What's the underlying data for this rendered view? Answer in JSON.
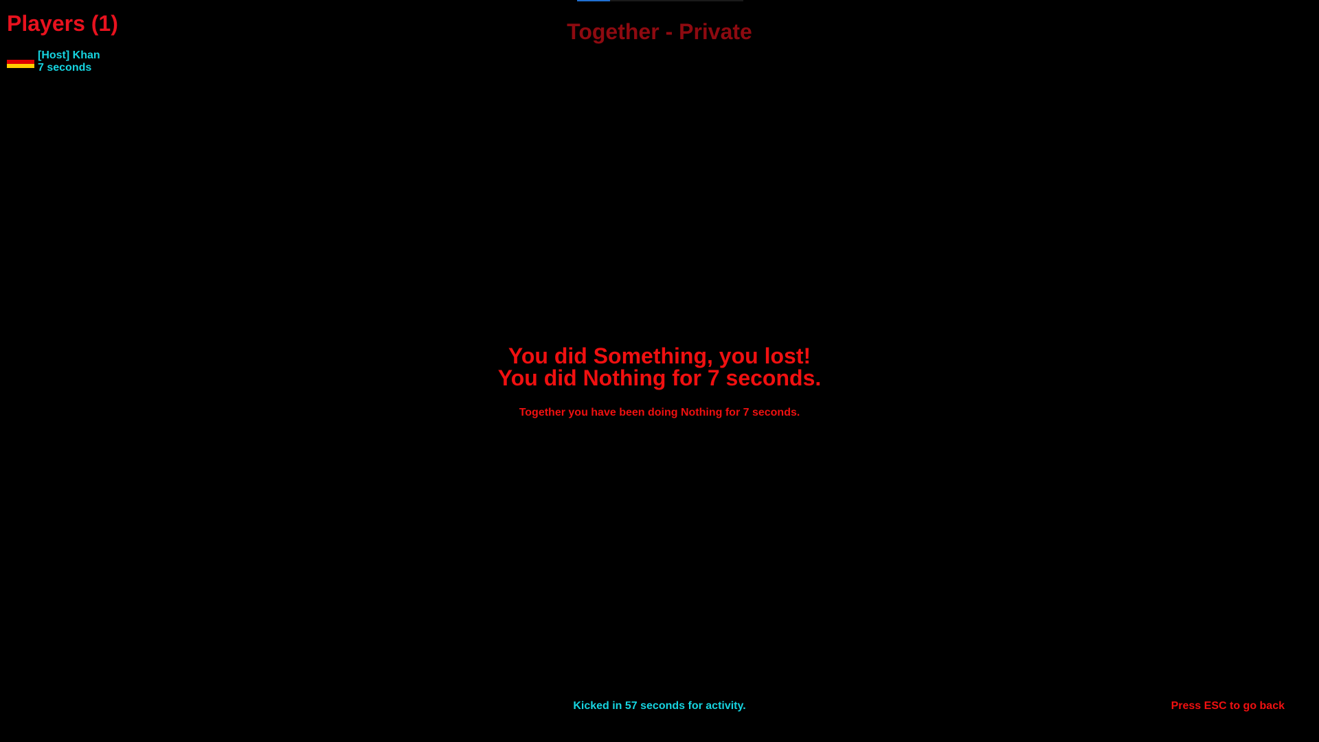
{
  "top_progress": {
    "value": 0.2,
    "fill_color": "#1f6fd1"
  },
  "players_panel": {
    "title": "Players (1)",
    "players": [
      {
        "flag_icon": "germany-flag-icon",
        "name": "[Host] Khan",
        "time": "7 seconds"
      }
    ]
  },
  "lobby": {
    "title": "Together - Private"
  },
  "result": {
    "line1": "You did Something, you lost!",
    "line2": "You did Nothing for 7 seconds.",
    "together": "Together you have been doing Nothing for 7 seconds."
  },
  "footer": {
    "kick_message": "Kicked in 57 seconds for activity.",
    "esc_hint": "Press ESC to go back"
  },
  "colors": {
    "background": "#000000",
    "red": "#f01010",
    "dark_red": "#8e0a10",
    "cyan": "#16d4e0"
  }
}
